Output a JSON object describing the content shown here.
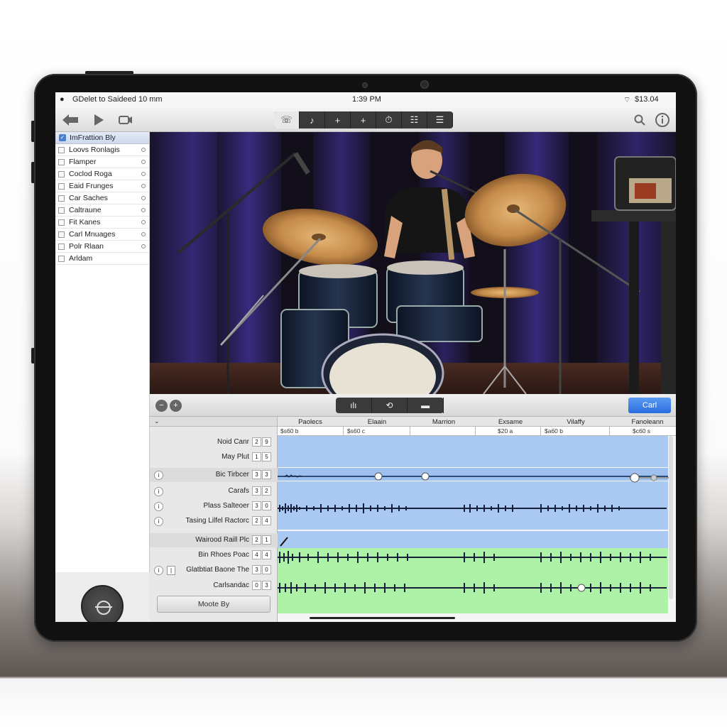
{
  "status_bar": {
    "left_text": "GDelet to Saideed  10 mm",
    "time": "1:39 PM",
    "right_text": "$13.04"
  },
  "toolbar": {
    "segment_icons": [
      "hat-icon",
      "note-icon",
      "plus-icon",
      "plus-icon",
      "metronome-icon",
      "mixer-icon",
      "list-icon"
    ]
  },
  "sidebar": {
    "header": "ImFrattion Bly",
    "items": [
      "Loovs Ronlagis",
      "Flamper",
      "Coclod Roga",
      "Eaid Frunges",
      "Car Saches",
      "Caltraune",
      "Fit Kanes",
      "Carl Mnuages",
      "Polr Rlaan",
      "Arldam"
    ]
  },
  "transport": {
    "card_button": "Carl"
  },
  "tracks": {
    "column_headers": [
      "Paolecs",
      "Elaain",
      "Marrion",
      "Exsame",
      "Vilaffy",
      "Fanoleann"
    ],
    "ticks": [
      "$s60 b",
      "$s60 c",
      "",
      "$20 a",
      "$a60 b",
      "$c60 s"
    ],
    "rows": [
      {
        "name": "Noid Canr",
        "n1": "2",
        "n2": "9"
      },
      {
        "name": "May Plut",
        "n1": "1",
        "n2": "5"
      },
      {
        "name": "Bic Tirbcer",
        "n1": "3",
        "n2": "3"
      },
      {
        "name": "Carafs",
        "n1": "3",
        "n2": "2"
      },
      {
        "name": "Plass Salteoer",
        "n1": "3",
        "n2": "0"
      },
      {
        "name": "Tasing Lilfel Ractorc",
        "n1": "2",
        "n2": "4"
      },
      {
        "name": "Wairood Raill Plc",
        "n1": "2",
        "n2": "1"
      },
      {
        "name": "Bin Rhoes Poac",
        "n1": "4",
        "n2": "4"
      },
      {
        "name": "Glatbtiat Baone The",
        "n1": "3",
        "n2": "0"
      },
      {
        "name": "Carlsandac",
        "n1": "0",
        "n2": "3"
      }
    ],
    "mode_button": "Moote By"
  },
  "colors": {
    "lane_blue": "#a9c9f2",
    "lane_green": "#aef2a8",
    "accent": "#2a6ce0"
  }
}
